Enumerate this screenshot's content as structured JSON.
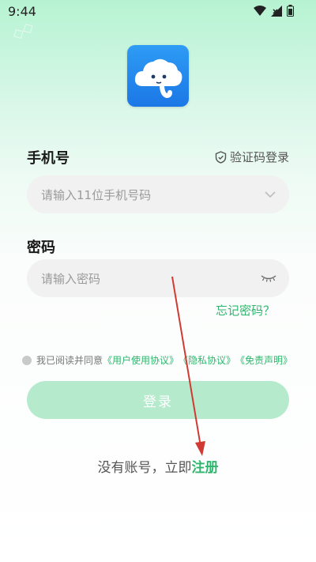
{
  "status_bar": {
    "time": "9:44"
  },
  "form": {
    "phone_label": "手机号",
    "verify_login": "验证码登录",
    "phone_placeholder": "请输入11位手机号码",
    "password_label": "密码",
    "password_placeholder": "请输入密码",
    "forgot_password": "忘记密码？"
  },
  "agreement": {
    "prefix": "我已阅读并同意",
    "user_agreement": "《用户使用协议》",
    "privacy": "《隐私协议》",
    "disclaimer": "《免责声明》"
  },
  "login_button": "登录",
  "register": {
    "prefix": "没有账号，立即",
    "link": "注册"
  },
  "colors": {
    "accent": "#2fb66d",
    "button": "#b5ebcc",
    "logo": "#1f86ee",
    "annotation_arrow": "#d13a32"
  },
  "icons": {
    "logo": "cloud-elephant-icon",
    "verify": "shield-check-icon",
    "dropdown": "chevron-down-icon",
    "password_toggle": "eye-closed-icon"
  }
}
